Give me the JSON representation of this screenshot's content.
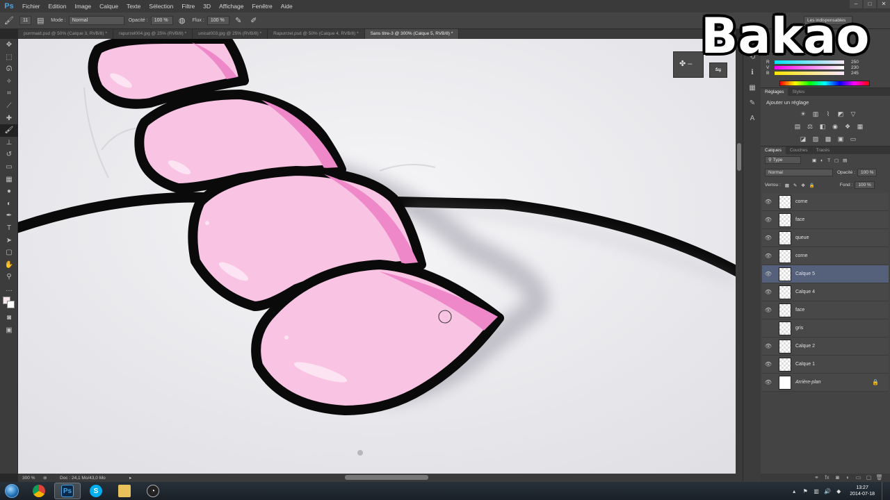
{
  "app": {
    "logo": "Ps"
  },
  "menu": [
    "Fichier",
    "Edition",
    "Image",
    "Calque",
    "Texte",
    "Sélection",
    "Filtre",
    "3D",
    "Affichage",
    "Fenêtre",
    "Aide"
  ],
  "window_controls": {
    "minimize": "–",
    "maximize": "□",
    "close": "✕"
  },
  "options_bar": {
    "brush_size": "11",
    "mode_label": "Mode :",
    "mode_value": "Normal",
    "opacity_label": "Opacité :",
    "opacity_value": "100 %",
    "flow_label": "Flux :",
    "flow_value": "100 %",
    "workspace": "Les indispensables"
  },
  "doc_tabs": [
    {
      "label": "purrmaid.psd @ 50% (Calque 3, RVB/8) *",
      "active": false
    },
    {
      "label": "rapurzel004.jpg @ 25% (RVB/8) *",
      "active": false
    },
    {
      "label": "unicat003.jpg @ 25% (RVB/8) *",
      "active": false
    },
    {
      "label": "Rapurrzel.psd @ 50% (Calque 4, RVB/8) *",
      "active": false
    },
    {
      "label": "Sans titre-3 @ 300% (Calque 5, RVB/8) *",
      "active": true
    }
  ],
  "status_bar": {
    "zoom": "300 %",
    "doc_info": "Doc : 24,1 Mo/43,0 Mo"
  },
  "color_panel": {
    "b_label": "B",
    "b_value": "245",
    "g_value": "230",
    "r_value": "250"
  },
  "adjustments": {
    "tabs": [
      "Réglages",
      "Styles"
    ],
    "title": "Ajouter un réglage"
  },
  "layers_panel": {
    "tabs": [
      "Calques",
      "Couches",
      "Tracés"
    ],
    "filter_type": "Type",
    "blend_mode": "Normal",
    "opacity_label": "Opacité :",
    "opacity_value": "100 %",
    "lock_label": "Verrou :",
    "fill_label": "Fond :",
    "fill_value": "100 %",
    "layers": [
      {
        "name": "corne",
        "visible": true,
        "selected": false
      },
      {
        "name": "face",
        "visible": true,
        "selected": false
      },
      {
        "name": "queue",
        "visible": true,
        "selected": false
      },
      {
        "name": "corne",
        "visible": true,
        "selected": false
      },
      {
        "name": "Calque 5",
        "visible": true,
        "selected": true
      },
      {
        "name": "Calque 4",
        "visible": true,
        "selected": false
      },
      {
        "name": "face",
        "visible": true,
        "selected": false
      },
      {
        "name": "gris",
        "visible": false,
        "selected": false
      },
      {
        "name": "Calque 2",
        "visible": true,
        "selected": false
      },
      {
        "name": "Calque 1",
        "visible": true,
        "selected": false
      },
      {
        "name": "Arrière-plan",
        "visible": true,
        "selected": false,
        "locked": true,
        "italic": true
      }
    ]
  },
  "watermark": "Bakao",
  "taskbar": {
    "apps": [
      {
        "name": "windows-explorer",
        "label": ""
      },
      {
        "name": "chrome",
        "label": ""
      },
      {
        "name": "photoshop",
        "label": "Ps"
      },
      {
        "name": "skype",
        "label": "S"
      },
      {
        "name": "folder",
        "label": ""
      },
      {
        "name": "obs",
        "label": ""
      }
    ],
    "time": "13:27",
    "date": "2014-07-18"
  },
  "colors": {
    "pink_fill": "#f9c3e3",
    "pink_shadow": "#ee88c9",
    "outline": "#0a0a0a",
    "selected_layer": "#55607a"
  }
}
